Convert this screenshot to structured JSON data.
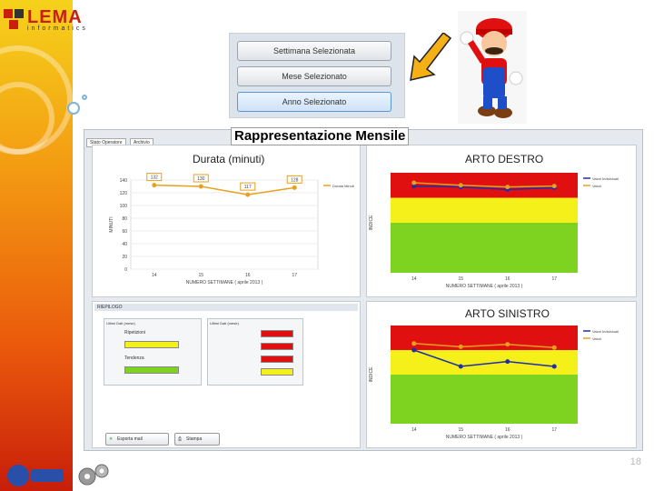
{
  "logo": {
    "brand": "LEMA",
    "sub": "informatics"
  },
  "selector_buttons": [
    {
      "label": "Settimana Selezionata",
      "active": false
    },
    {
      "label": "Mese Selezionato",
      "active": false
    },
    {
      "label": "Anno Selezionato",
      "active": true
    }
  ],
  "slide_title": "Rappresentazione Mensile",
  "app": {
    "tabs": [
      "Stato Operatore",
      "Archivio"
    ],
    "colors": {
      "red": "#e01010",
      "yellow": "#f5f01a",
      "green": "#7ed321",
      "series_blue": "#1f2fa8",
      "series_orange": "#e8a020"
    }
  },
  "chart_data": [
    {
      "type": "line",
      "title": "Durata (minuti)",
      "xlabel": "NUMERO SETTIMANE ( aprile 2013 )",
      "ylabel": "MINUTI",
      "categories": [
        "14",
        "15",
        "16",
        "17"
      ],
      "ylim": [
        0,
        140
      ],
      "yticks": [
        "0",
        "20",
        "40",
        "60",
        "80",
        "100",
        "120",
        "140"
      ],
      "series": [
        {
          "name": "Durata Minuti",
          "values": [
            132,
            130,
            117,
            128
          ],
          "labels": [
            "132",
            "130",
            "117",
            "128"
          ]
        }
      ]
    },
    {
      "type": "line",
      "title": "ARTO DESTRO",
      "xlabel": "NUMERO SETTIMANE ( aprile 2013 )",
      "ylabel": "INDICE",
      "categories": [
        "14",
        "15",
        "16",
        "17"
      ],
      "ylim": [
        0,
        12
      ],
      "bands": [
        {
          "from": 0,
          "to": 6,
          "color": "green"
        },
        {
          "from": 6,
          "to": 9,
          "color": "yellow"
        },
        {
          "from": 9,
          "to": 12,
          "color": "red"
        }
      ],
      "series": [
        {
          "name": "Valori Individuali",
          "values": [
            10.4,
            10.3,
            10.0,
            10.2
          ]
        },
        {
          "name": "Valori",
          "values": [
            10.8,
            10.5,
            10.3,
            10.4
          ]
        }
      ]
    },
    {
      "type": "line",
      "title": "ARTO SINISTRO",
      "xlabel": "NUMERO SETTIMANE ( aprile 2013 )",
      "ylabel": "INDICE",
      "categories": [
        "14",
        "15",
        "16",
        "17"
      ],
      "ylim": [
        0,
        12
      ],
      "bands": [
        {
          "from": 0,
          "to": 6,
          "color": "green"
        },
        {
          "from": 6,
          "to": 9,
          "color": "yellow"
        },
        {
          "from": 9,
          "to": 12,
          "color": "red"
        }
      ],
      "series": [
        {
          "name": "Valori Individuali",
          "values": [
            9.0,
            7.0,
            7.6,
            7.0
          ]
        },
        {
          "name": "Valori",
          "values": [
            9.8,
            9.4,
            9.7,
            9.3
          ]
        }
      ]
    }
  ],
  "summary": {
    "label": "RIEPILOGO",
    "left_title": "Ultimi Dati (mese)",
    "right_title": "Ultimi Dati (mese)",
    "left_rows": [
      {
        "label": "Ripetizioni",
        "value": "",
        "color": "#f5f01a"
      },
      {
        "label": "Tendenza",
        "value": "",
        "color": "#7ed321"
      }
    ],
    "right_rows": [
      {
        "label": "",
        "value": "",
        "color": "#e01010"
      },
      {
        "label": "",
        "value": "",
        "color": "#e01010"
      },
      {
        "label": "",
        "value": "",
        "color": "#e01010"
      },
      {
        "label": "",
        "value": "",
        "color": "#f5f01a"
      }
    ]
  },
  "footer_buttons": [
    "Esporta mail",
    "Stampa"
  ],
  "page_number": "18"
}
